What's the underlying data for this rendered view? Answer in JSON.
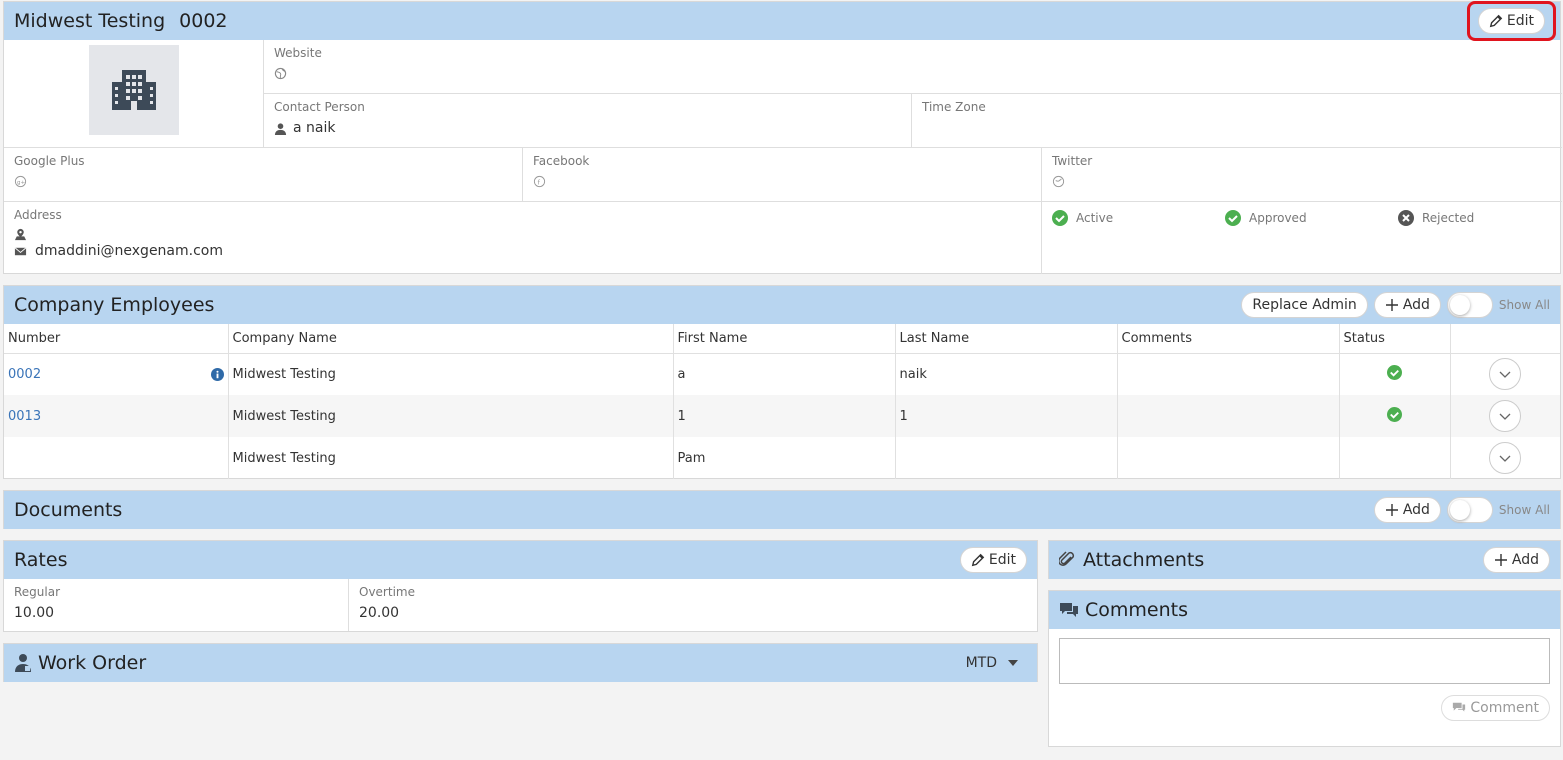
{
  "company": {
    "name": "Midwest Testing",
    "number": "0002",
    "edit_label": "Edit",
    "website_label": "Website",
    "contact_label": "Contact Person",
    "contact_value": "a naik",
    "timezone_label": "Time Zone",
    "googleplus_label": "Google Plus",
    "facebook_label": "Facebook",
    "twitter_label": "Twitter",
    "address_label": "Address",
    "email": "dmaddini@nexgenam.com",
    "status_active": "Active",
    "status_approved": "Approved",
    "status_rejected": "Rejected"
  },
  "employees": {
    "title": "Company Employees",
    "replace_admin": "Replace Admin",
    "add": "Add",
    "show_all": "Show All",
    "columns": [
      "Number",
      "Company Name",
      "First Name",
      "Last Name",
      "Comments",
      "Status"
    ],
    "rows": [
      {
        "number": "0002",
        "company": "Midwest Testing",
        "first": "a",
        "last": "naik",
        "comments": "",
        "active": true,
        "info": true
      },
      {
        "number": "0013",
        "company": "Midwest Testing",
        "first": "1",
        "last": "1",
        "comments": "",
        "active": true,
        "info": false
      },
      {
        "number": "",
        "company": "Midwest Testing",
        "first": "Pam",
        "last": "",
        "comments": "",
        "active": false,
        "info": false
      }
    ]
  },
  "documents": {
    "title": "Documents",
    "add": "Add",
    "show_all": "Show All"
  },
  "rates": {
    "title": "Rates",
    "edit": "Edit",
    "regular_label": "Regular",
    "regular_value": "10.00",
    "overtime_label": "Overtime",
    "overtime_value": "20.00"
  },
  "work_order": {
    "title": "Work Order",
    "filter": "MTD"
  },
  "attachments": {
    "title": "Attachments",
    "add": "Add"
  },
  "comments": {
    "title": "Comments",
    "button": "Comment",
    "placeholder": ""
  },
  "colors": {
    "header": "#b8d5f0",
    "accent": "#3a74b8",
    "success": "#4caf50",
    "highlight": "#e0141e"
  }
}
